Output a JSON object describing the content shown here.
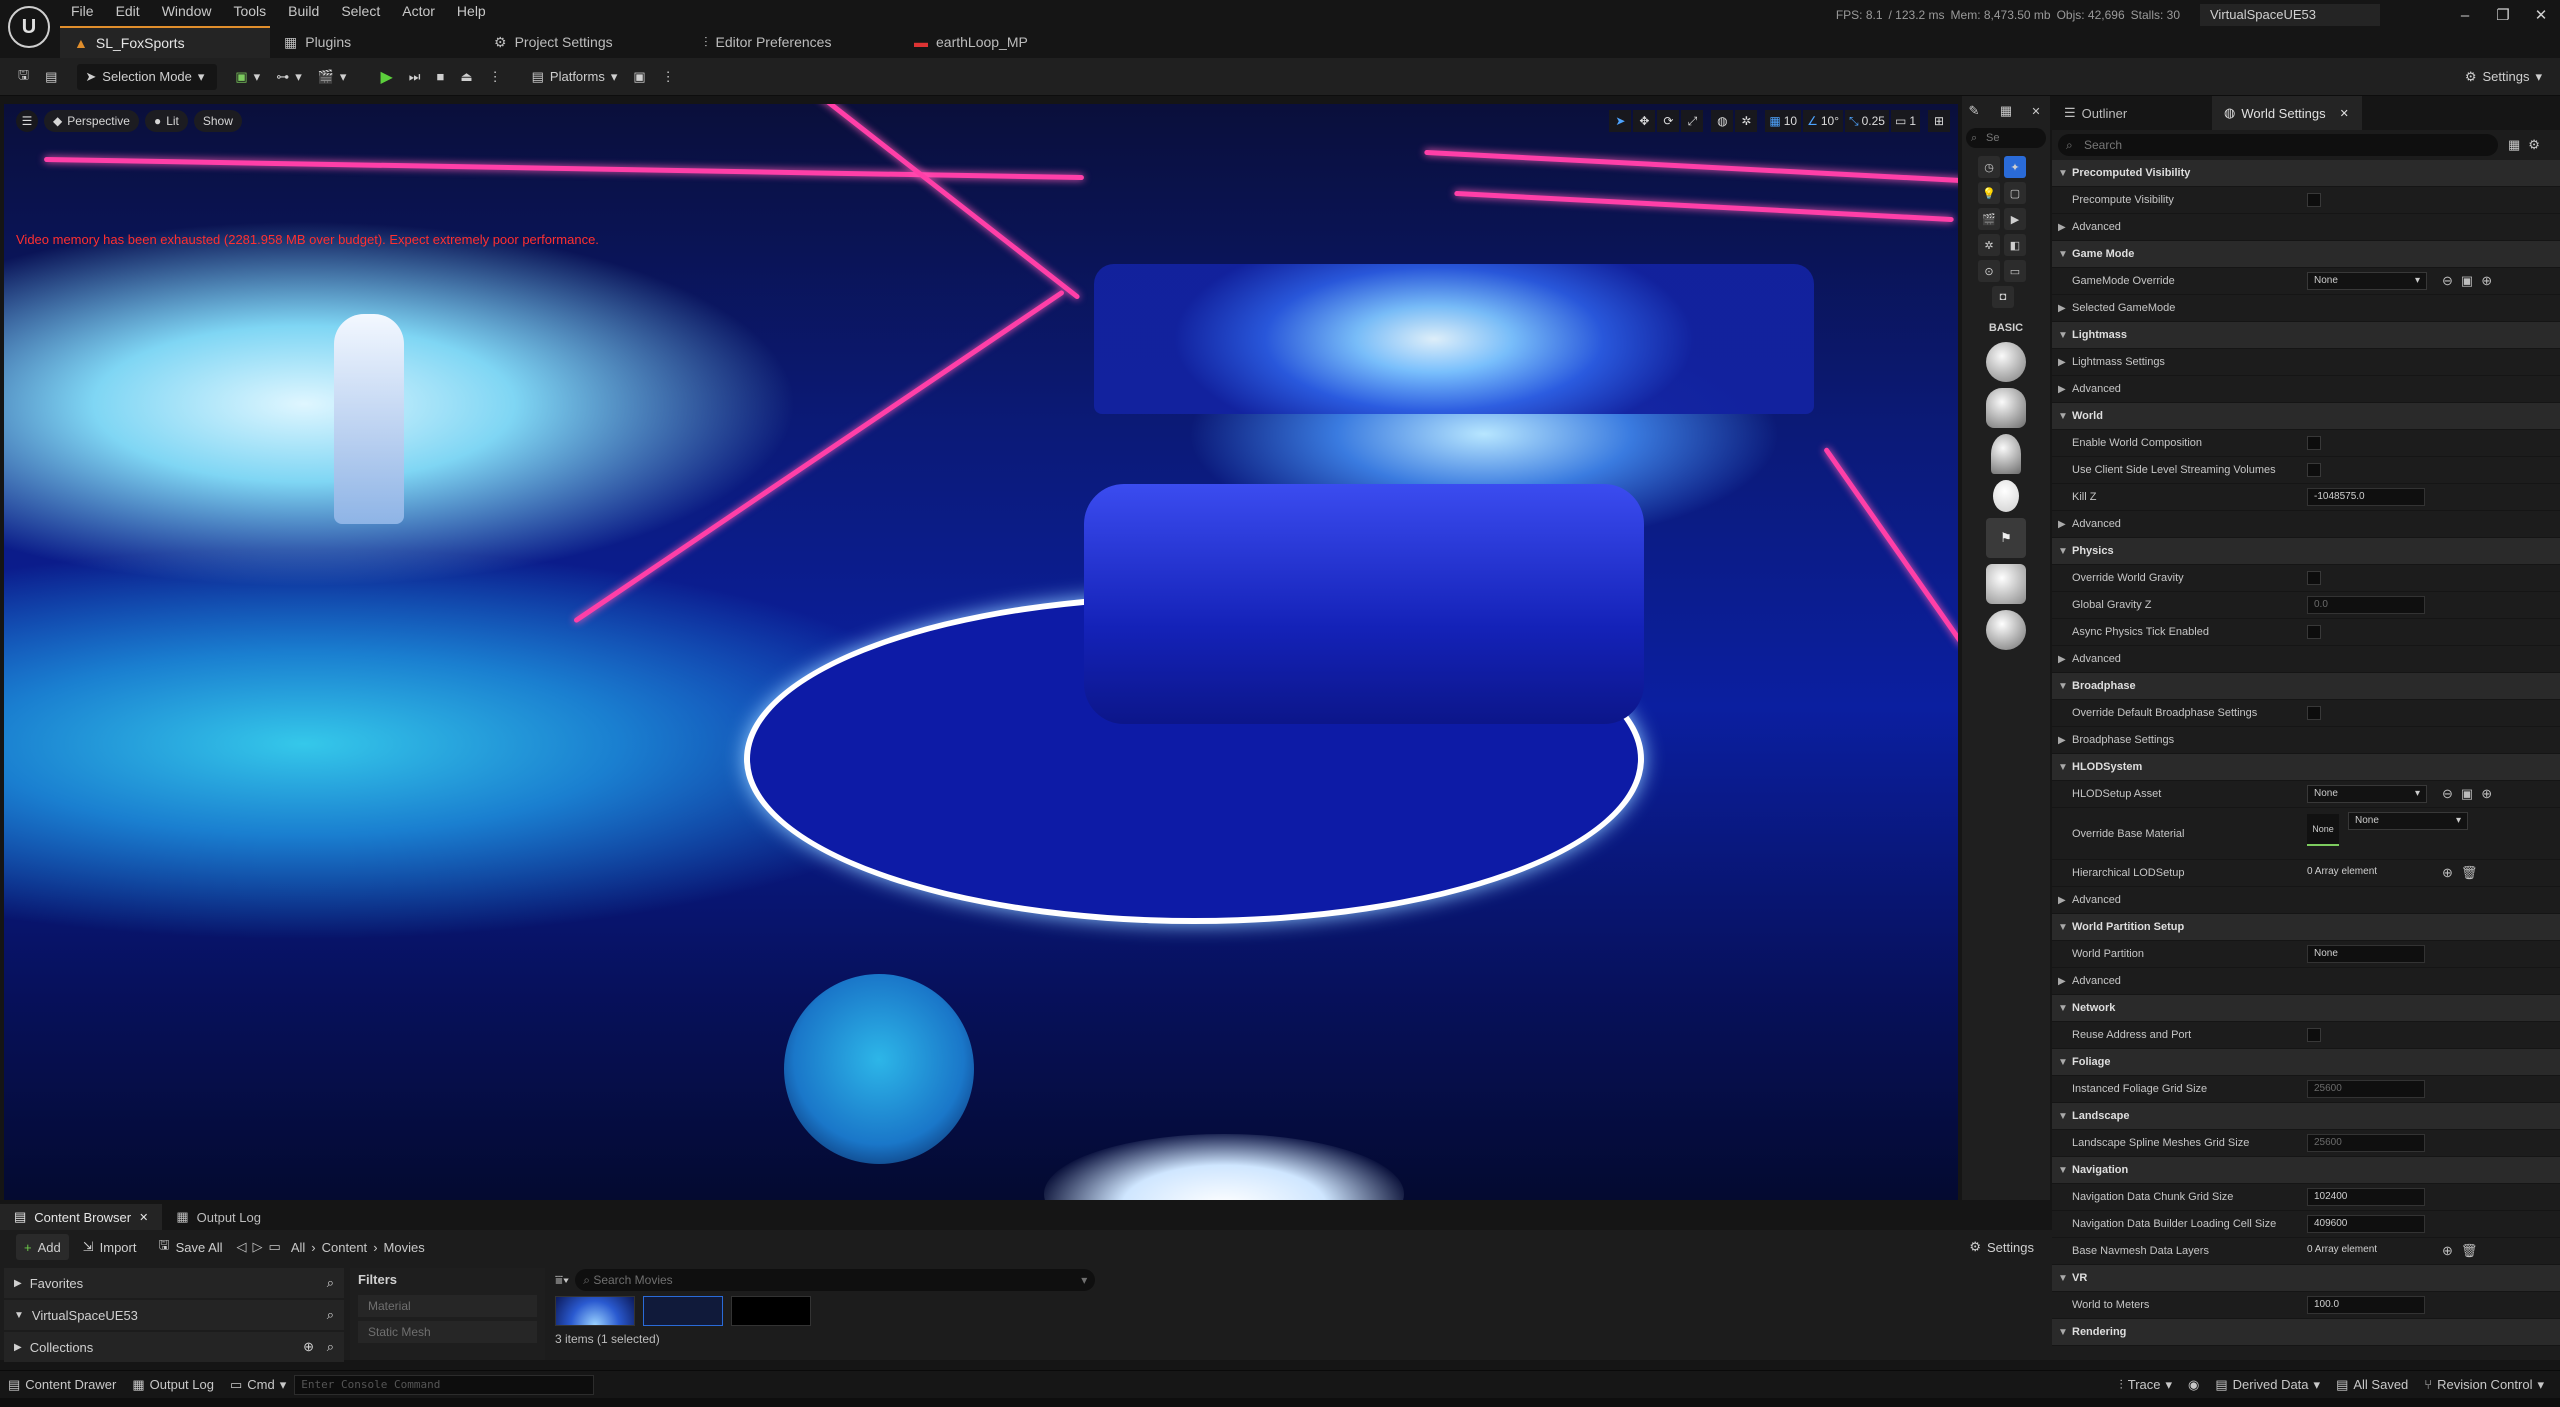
{
  "menu": [
    "File",
    "Edit",
    "Window",
    "Tools",
    "Build",
    "Select",
    "Actor",
    "Help"
  ],
  "tabs": [
    {
      "label": "SL_FoxSports",
      "icon": "level-icon",
      "active": true
    },
    {
      "label": "Plugins",
      "icon": "plugin-icon"
    },
    {
      "label": "Project Settings",
      "icon": "settings-icon"
    },
    {
      "label": "Editor Preferences",
      "icon": "sliders-icon"
    },
    {
      "label": "earthLoop_MP",
      "icon": "media-player-icon"
    }
  ],
  "stats": {
    "fps": "FPS: 8.1",
    "frame": "/ 123.2 ms",
    "mem": "Mem: 8,473.50 mb",
    "objs": "Objs: 42,696",
    "stalls": "Stalls: 30"
  },
  "project_name": "VirtualSpaceUE53",
  "toolbar": {
    "selection_mode": "Selection Mode",
    "platforms": "Platforms",
    "settings": "Settings"
  },
  "viewport": {
    "perspective": "Perspective",
    "lit": "Lit",
    "show": "Show",
    "warning": "Video memory has been exhausted (2281.958 MB over budget). Expect extremely poor performance.",
    "grid_snap": "10",
    "rot_snap": "10°",
    "scale_snap": "0.25",
    "camera_speed": "1"
  },
  "place_actors": {
    "search_placeholder": "Se",
    "category": "BASIC"
  },
  "details": {
    "tabs": [
      {
        "label": "Outliner"
      },
      {
        "label": "World Settings"
      }
    ],
    "search_placeholder": "Search",
    "rows": [
      {
        "type": "sec",
        "label": "Precomputed Visibility"
      },
      {
        "type": "prop",
        "label": "Precompute Visibility",
        "control": "check"
      },
      {
        "type": "adv",
        "label": "Advanced"
      },
      {
        "type": "sec",
        "label": "Game Mode"
      },
      {
        "type": "prop",
        "label": "GameMode Override",
        "control": "combo",
        "value": "None"
      },
      {
        "type": "adv",
        "label": "Selected GameMode"
      },
      {
        "type": "sec",
        "label": "Lightmass"
      },
      {
        "type": "adv",
        "label": "Lightmass Settings"
      },
      {
        "type": "adv",
        "label": "Advanced"
      },
      {
        "type": "sec",
        "label": "World"
      },
      {
        "type": "prop",
        "label": "Enable World Composition",
        "control": "check"
      },
      {
        "type": "prop",
        "label": "Use Client Side Level Streaming Volumes",
        "control": "check"
      },
      {
        "type": "prop",
        "label": "Kill Z",
        "control": "field",
        "value": "-1048575.0"
      },
      {
        "type": "adv",
        "label": "Advanced"
      },
      {
        "type": "sec",
        "label": "Physics"
      },
      {
        "type": "prop",
        "label": "Override World Gravity",
        "control": "check"
      },
      {
        "type": "prop",
        "label": "Global Gravity Z",
        "control": "field-dim",
        "value": "0.0"
      },
      {
        "type": "prop",
        "label": "Async Physics Tick Enabled",
        "control": "check"
      },
      {
        "type": "adv",
        "label": "Advanced"
      },
      {
        "type": "sec",
        "label": "Broadphase"
      },
      {
        "type": "prop",
        "label": "Override Default Broadphase Settings",
        "control": "check"
      },
      {
        "type": "adv",
        "label": "Broadphase Settings"
      },
      {
        "type": "sec",
        "label": "HLODSystem"
      },
      {
        "type": "prop",
        "label": "HLODSetup Asset",
        "control": "combo",
        "value": "None"
      },
      {
        "type": "tall",
        "label": "Override Base Material",
        "value": "None",
        "thumb": "None"
      },
      {
        "type": "prop",
        "label": "Hierarchical LODSetup",
        "control": "text",
        "value": "0 Array element"
      },
      {
        "type": "adv",
        "label": "Advanced"
      },
      {
        "type": "sec",
        "label": "World Partition Setup"
      },
      {
        "type": "prop",
        "label": "World Partition",
        "control": "field",
        "value": "None"
      },
      {
        "type": "adv",
        "label": "Advanced"
      },
      {
        "type": "sec",
        "label": "Network"
      },
      {
        "type": "prop",
        "label": "Reuse Address and Port",
        "control": "check"
      },
      {
        "type": "sec",
        "label": "Foliage"
      },
      {
        "type": "prop",
        "label": "Instanced Foliage Grid Size",
        "control": "field-dim",
        "value": "25600"
      },
      {
        "type": "sec",
        "label": "Landscape"
      },
      {
        "type": "prop",
        "label": "Landscape Spline Meshes Grid Size",
        "control": "field-dim",
        "value": "25600"
      },
      {
        "type": "sec",
        "label": "Navigation"
      },
      {
        "type": "prop",
        "label": "Navigation Data Chunk Grid Size",
        "control": "field",
        "value": "102400"
      },
      {
        "type": "prop",
        "label": "Navigation Data Builder Loading Cell Size",
        "control": "field",
        "value": "409600"
      },
      {
        "type": "prop",
        "label": "Base Navmesh Data Layers",
        "control": "text",
        "value": "0 Array element"
      },
      {
        "type": "sec",
        "label": "VR"
      },
      {
        "type": "prop",
        "label": "World to Meters",
        "control": "field",
        "value": "100.0"
      },
      {
        "type": "sec",
        "label": "Rendering"
      }
    ]
  },
  "content_browser": {
    "tabs": [
      "Content Browser",
      "Output Log"
    ],
    "add": "Add",
    "import": "Import",
    "save_all": "Save All",
    "breadcrumb": [
      "All",
      "Content",
      "Movies"
    ],
    "settings": "Settings",
    "favorites": "Favorites",
    "project": "VirtualSpaceUE53",
    "collections": "Collections",
    "filters_title": "Filters",
    "filters": [
      "Material",
      "Static Mesh"
    ],
    "search_placeholder": "Search Movies",
    "items_count": "3 items (1 selected)"
  },
  "statusbar": {
    "content_drawer": "Content Drawer",
    "output_log": "Output Log",
    "cmd": "Cmd",
    "console_placeholder": "Enter Console Command",
    "trace": "Trace",
    "derived_data": "Derived Data",
    "all_saved": "All Saved",
    "revision_control": "Revision Control"
  }
}
